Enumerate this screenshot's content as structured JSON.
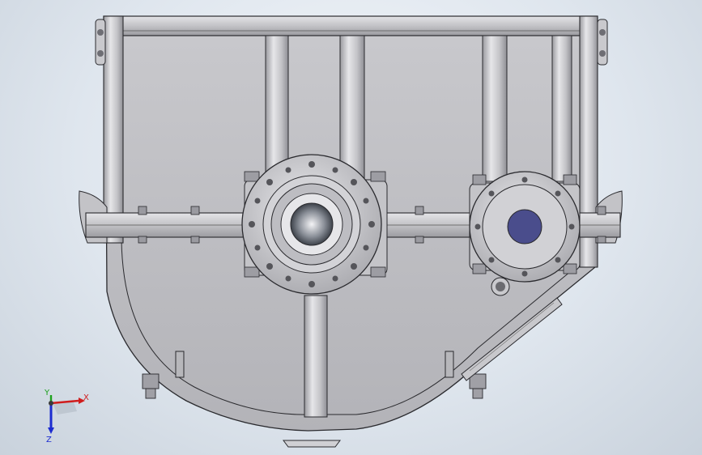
{
  "viewport": {
    "colors": {
      "background_light": "#f4f7fb",
      "background_dark": "#c9d2dc",
      "steel_light": "#d9d9dc",
      "steel_mid": "#b7b7bb",
      "steel_dark": "#8e8e94",
      "edge": "#2a2a2e",
      "port_blue": "#4a4d8c"
    }
  },
  "triad": {
    "x_label": "X",
    "y_label": "Y",
    "z_label": "Z",
    "colors": {
      "x": "#d01c1c",
      "y": "#1ca01c",
      "z": "#1c2cd0"
    }
  }
}
